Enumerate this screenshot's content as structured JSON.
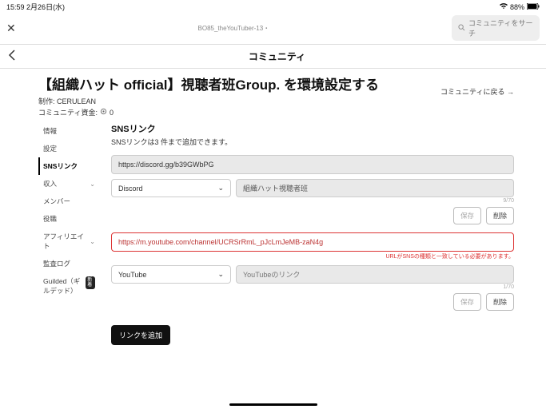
{
  "status": {
    "time": "15:59",
    "date": "2月26日(水)",
    "battery": "88%"
  },
  "topbar": {
    "context": "BO85_theYouTuber-13・"
  },
  "search": {
    "placeholder": "コミュニティをサーチ"
  },
  "nav": {
    "title": "コミュニティ"
  },
  "page": {
    "title": "【組織ハット official】視聴者班Group. を環境設定する",
    "producer_label": "制作:",
    "producer": "CERULEAN",
    "funds_label": "コミュニティ資金:",
    "funds_value": "0",
    "return_link": "コミュニティに戻る →"
  },
  "sidebar": {
    "items": [
      "情報",
      "設定",
      "SNSリンク",
      "収入",
      "メンバー",
      "役職",
      "アフィリエイト",
      "監査ログ"
    ],
    "guilded_label": "Guilded（ギルデッド）",
    "guilded_badge": "新\n着"
  },
  "sns": {
    "title": "SNSリンク",
    "desc": "SNSリンクは3 件まで追加できます。",
    "blocks": [
      {
        "url": "https://discord.gg/b39GWbPG",
        "platform": "Discord",
        "name": "組織ハット視聴者班",
        "counter": "9/70",
        "error": ""
      },
      {
        "url": "https://m.youtube.com/channel/UCRSrRmL_pJcLmJeMB-zaN4g",
        "platform": "YouTube",
        "name_placeholder": "YouTubeのリンク",
        "counter": "1/70",
        "error": "URLがSNSの種類と一致している必要があります。"
      }
    ],
    "save_label": "保存",
    "delete_label": "削除",
    "add_label": "リンクを追加"
  }
}
